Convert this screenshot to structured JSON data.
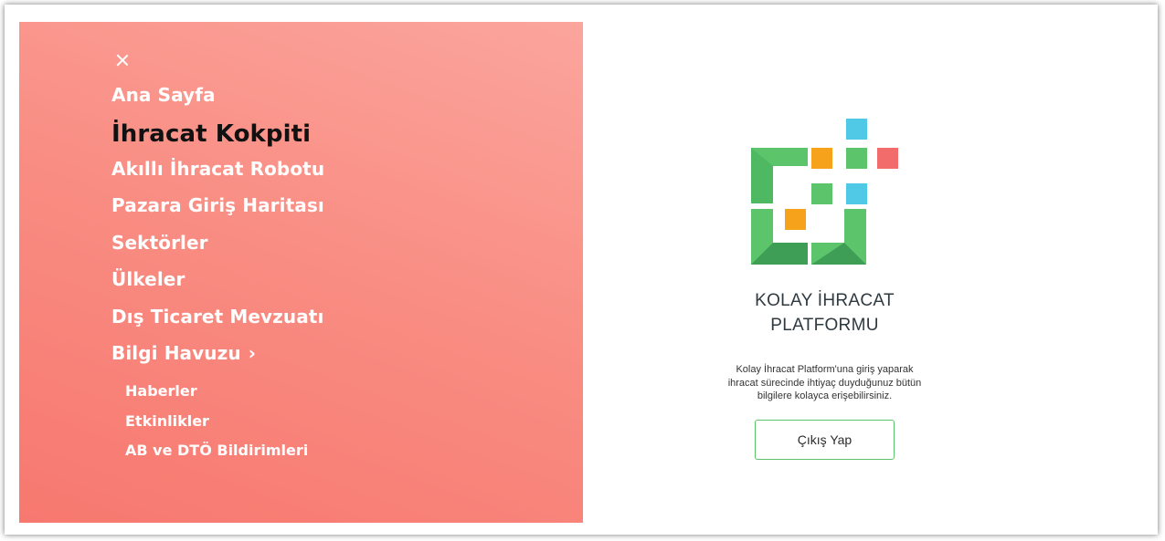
{
  "menu": {
    "items": [
      {
        "label": "Ana Sayfa"
      },
      {
        "label": "İhracat Kokpiti",
        "active": true
      },
      {
        "label": "Akıllı İhracat Robotu"
      },
      {
        "label": "Pazara Giriş Haritası"
      },
      {
        "label": "Sektörler"
      },
      {
        "label": "Ülkeler"
      },
      {
        "label": "Dış Ticaret Mevzuatı"
      },
      {
        "label": "Bilgi Havuzu"
      }
    ],
    "bilgi_havuzu_chevron": "›",
    "sub_items": [
      {
        "label": "Haberler"
      },
      {
        "label": "Etkinlikler"
      },
      {
        "label": "AB ve DTÖ Bildirimleri"
      }
    ],
    "background_gradient": [
      "#fba59d",
      "#f7786f"
    ],
    "active_color": "#111111"
  },
  "brand": {
    "line1": "KOLAY İHRACAT",
    "line2": "PLATFORMU",
    "description_line1": "Kolay İhracat Platform'una giriş yaparak",
    "description_line2": "ihracat sürecinde ihtiyaç duyduğunuz bütün",
    "description_line3": "bilgilere kolayca erişebilirsiniz.",
    "logo_colors": {
      "green": "#5cc56b",
      "dark_green": "#3f9e55",
      "orange": "#f7a21b",
      "blue": "#4fc9e6",
      "red": "#f26c6c"
    }
  },
  "actions": {
    "logout_label": "Çıkış Yap"
  }
}
